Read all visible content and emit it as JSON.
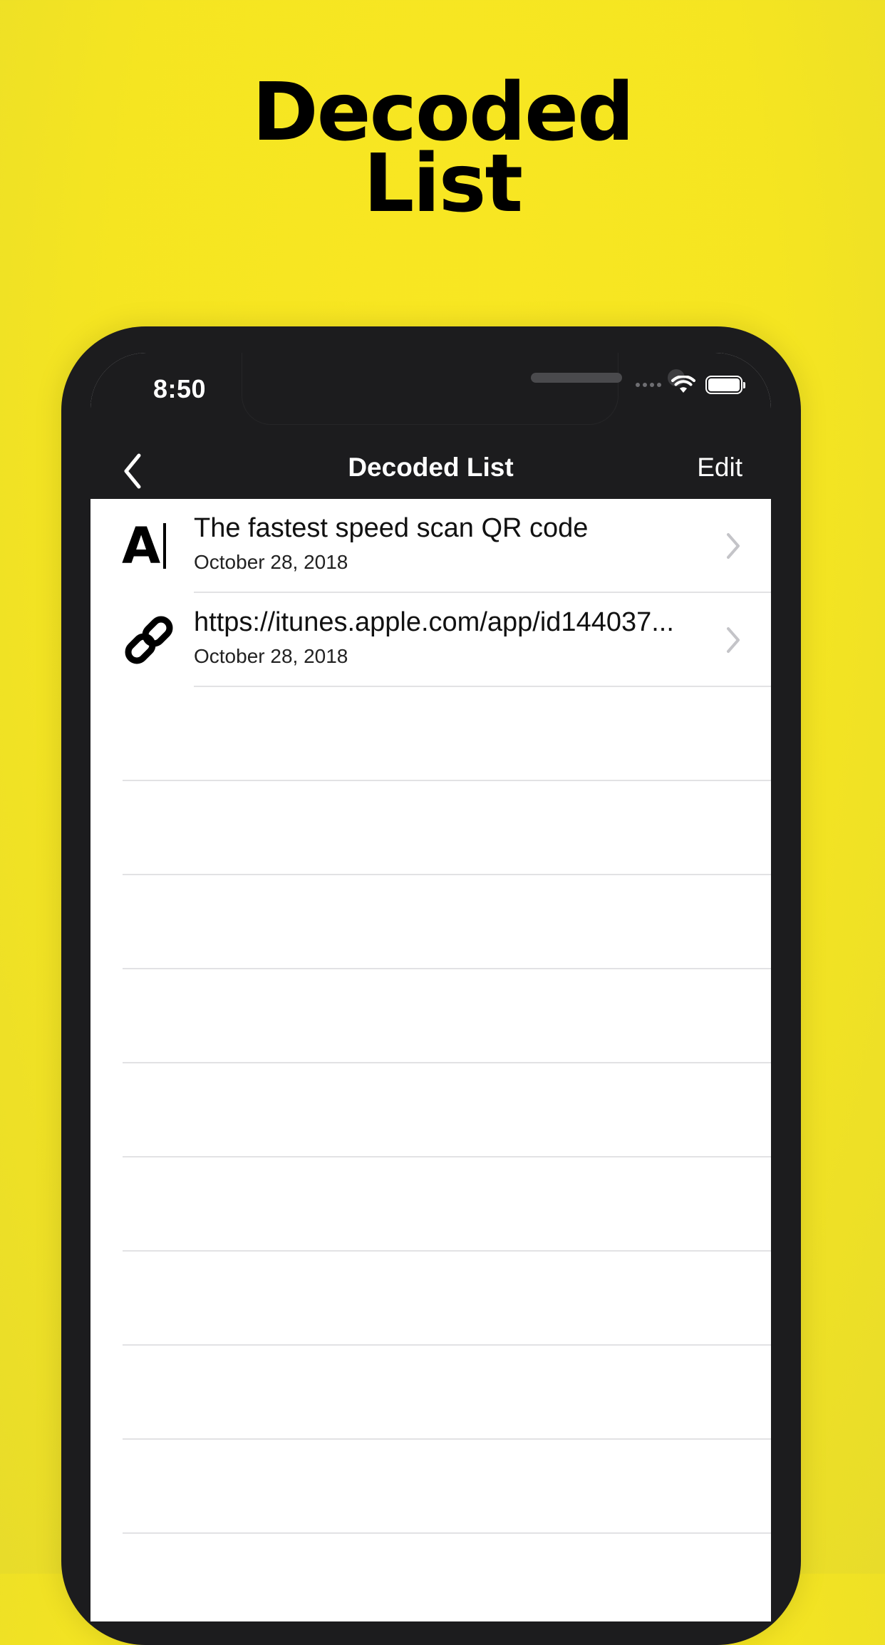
{
  "promo": {
    "headline_line1": "Decoded",
    "headline_line2": "List"
  },
  "status_bar": {
    "time": "8:50"
  },
  "nav": {
    "title": "Decoded List",
    "edit_label": "Edit"
  },
  "items": [
    {
      "icon": "text-type-icon",
      "icon_text": "A",
      "title": "The fastest speed scan QR code",
      "date": "October 28, 2018"
    },
    {
      "icon": "link-icon",
      "title": "https://itunes.apple.com/app/id144037...",
      "date": "October 28, 2018"
    }
  ]
}
